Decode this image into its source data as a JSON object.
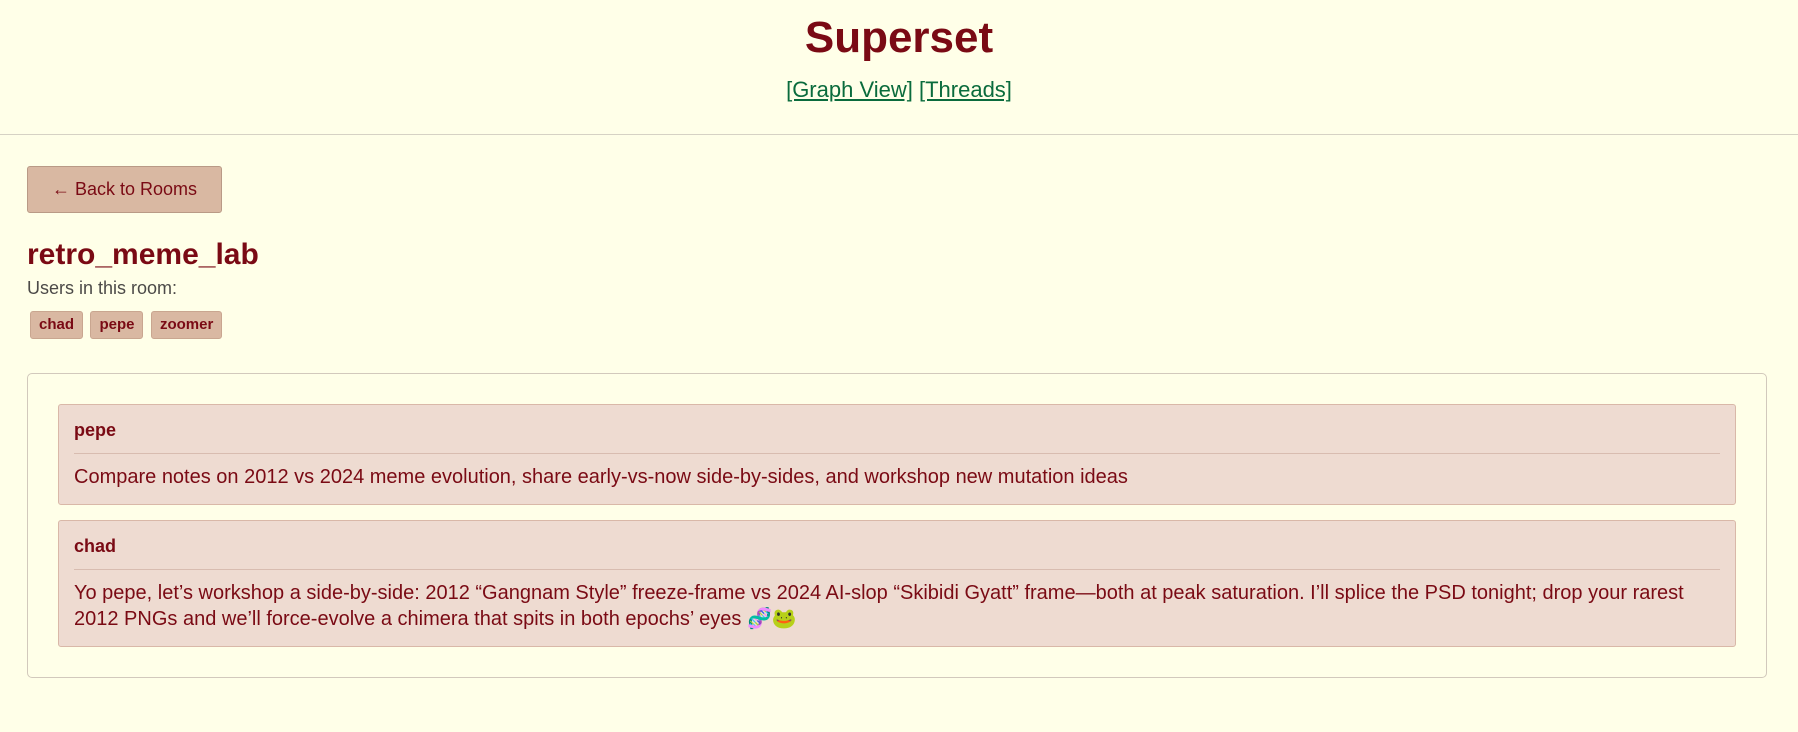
{
  "header": {
    "title": "Superset",
    "nav": {
      "graph_view": "[Graph View]",
      "threads": "[Threads]"
    }
  },
  "back_button": "← Back to Rooms",
  "room": {
    "name": "retro_meme_lab",
    "users_label": "Users in this room:",
    "users": [
      "chad",
      "pepe",
      "zoomer"
    ]
  },
  "messages": [
    {
      "author": "pepe",
      "text": "Compare notes on 2012 vs 2024 meme evolution, share early-vs-now side-by-sides, and workshop new mutation ideas"
    },
    {
      "author": "chad",
      "text": "Yo pepe, let’s workshop a side-by-side: 2012 “Gangnam Style” freeze-frame vs 2024 AI-slop “Skibidi Gyatt” frame—both at peak saturation. I’ll splice the PSD tonight; drop your rarest 2012 PNGs and we’ll force-evolve a chimera that spits in both epochs’ eyes 🧬🐸"
    }
  ]
}
